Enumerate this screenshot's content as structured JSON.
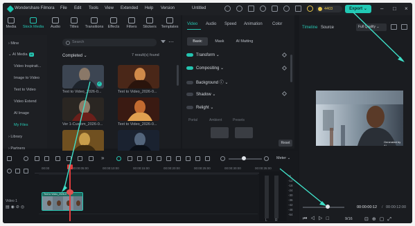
{
  "titlebar": {
    "app_name": "Wondershare Filmora",
    "menu": [
      "File",
      "Edit",
      "Tools",
      "View",
      "Extended",
      "Help",
      "Version"
    ],
    "project_title": "Untitled",
    "credits": "4403",
    "export_label": "Export"
  },
  "media_tabs": [
    "Media",
    "Stock Media",
    "Audio",
    "Titles",
    "Transitions",
    "Effects",
    "Filters",
    "Stickers",
    "Templates"
  ],
  "sidebar": {
    "items": [
      "Mine",
      "AI Media",
      "Video Inspirati...",
      "Image to Video",
      "Text to Video",
      "Video Extend",
      "AI Image",
      "My Files",
      "Library",
      "Partners"
    ],
    "ai_badge": "AI"
  },
  "library": {
    "search_placeholder": "Search",
    "section_title": "Completed",
    "result_count": "7 result(s) found",
    "thumbs": [
      {
        "caption": "Text to Video_2026-0...",
        "colors": [
          "#3c4552",
          "#8a7868",
          "#1d232b"
        ]
      },
      {
        "caption": "Text to Video_2026-0...",
        "colors": [
          "#4a2718",
          "#d08a4a",
          "#2a140c"
        ]
      },
      {
        "caption": "Ver 1-Custom_2026-0...",
        "colors": [
          "#2a2622",
          "#8e7a66",
          "#6a1f1a"
        ]
      },
      {
        "caption": "Text to Video_2026-0...",
        "colors": [
          "#3a1a12",
          "#c26a30",
          "#e0a050"
        ]
      },
      {
        "caption": "",
        "colors": [
          "#705020",
          "#c79d4a",
          "#3b2a10"
        ]
      },
      {
        "caption": "",
        "colors": [
          "#1a2230",
          "#53657c",
          "#0b1018"
        ]
      }
    ]
  },
  "inspector": {
    "tabs": [
      "Video",
      "Audio",
      "Speed",
      "Animation",
      "Color"
    ],
    "subtabs": [
      "Basic",
      "Mask",
      "AI Matting"
    ],
    "properties": [
      "Transform",
      "Compositing",
      "Background",
      "Shadow",
      "Relight"
    ],
    "presets": [
      "Portal",
      "Ambient",
      "Presets"
    ],
    "reset_label": "Reset"
  },
  "preview": {
    "tabs": [
      "Timeline",
      "Source"
    ],
    "quality": "Full Quality",
    "watermark": "Generated by AI",
    "current_time": "00:00:00:12",
    "total_time": "00:00:12:00",
    "speed": "9/16"
  },
  "timeline": {
    "meter_label": "Meter",
    "ruler": [
      "00:00",
      "00:00:05:00",
      "00:00:10:00",
      "00:00:15:00",
      "00:00:20:00",
      "00:00:25:00",
      "00:00:30:00",
      "00:00:35:00"
    ],
    "track_label": "Video 1",
    "meter_db": [
      "-6",
      "-12",
      "-18",
      "-24",
      "-30",
      "-36",
      "-42",
      "-48",
      "-54"
    ],
    "clip_label": "Text to Video_2026-0"
  }
}
